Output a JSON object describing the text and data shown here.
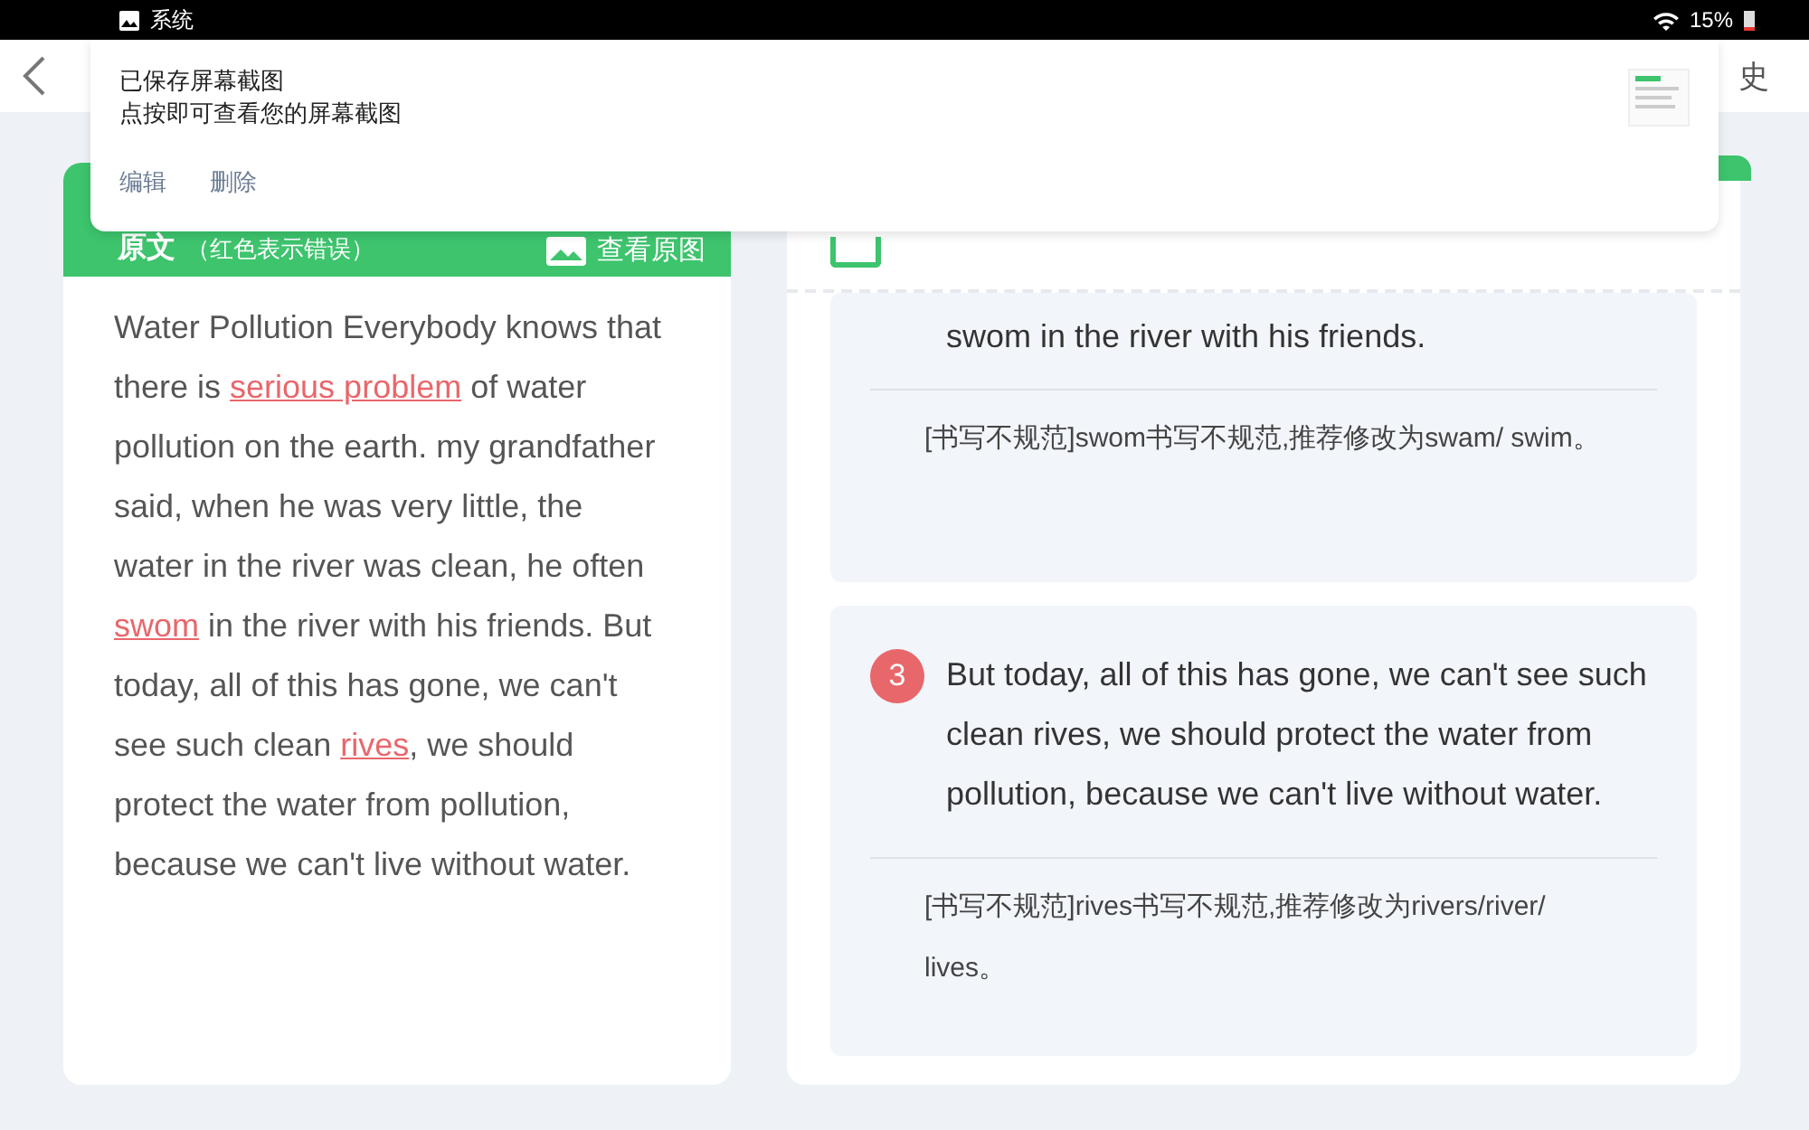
{
  "status_bar": {
    "app": "系统",
    "battery": "15%"
  },
  "app_bar": {
    "title_fragment": "史"
  },
  "notification": {
    "title": "已保存屏幕截图",
    "subtitle": "点按即可查看您的屏幕截图",
    "actions": [
      "编辑",
      "删除"
    ]
  },
  "original_panel": {
    "title": "原文",
    "hint": "（红色表示错误）",
    "view_button": "查看原图",
    "segments": [
      {
        "text": "Water Pollution  Everybody knows that there is ",
        "error": false
      },
      {
        "text": "serious problem",
        "error": true
      },
      {
        "text": " of water pollution on the earth. my grandfather said, when he was very little, the water in the river was clean, he often ",
        "error": false
      },
      {
        "text": "swom",
        "error": true
      },
      {
        "text": " in the river with his friends.  But today, all of this has gone, we can't see such clean ",
        "error": false
      },
      {
        "text": "rives",
        "error": true
      },
      {
        "text": ", we should protect the water from pollution, because we can't live without water.",
        "error": false
      }
    ]
  },
  "corrections": [
    {
      "sentence": "swom in the river with his friends.",
      "comment": "[书写不规范]swom书写不规范,推荐修改为swam/ swim。"
    },
    {
      "number": "3",
      "sentence": "But today, all of this has gone, we can't see such clean rives, we should protect the water from pollution, because we can't live without water.",
      "comment": "[书写不规范]rives书写不规范,推荐修改为rivers/river/ lives。"
    }
  ]
}
